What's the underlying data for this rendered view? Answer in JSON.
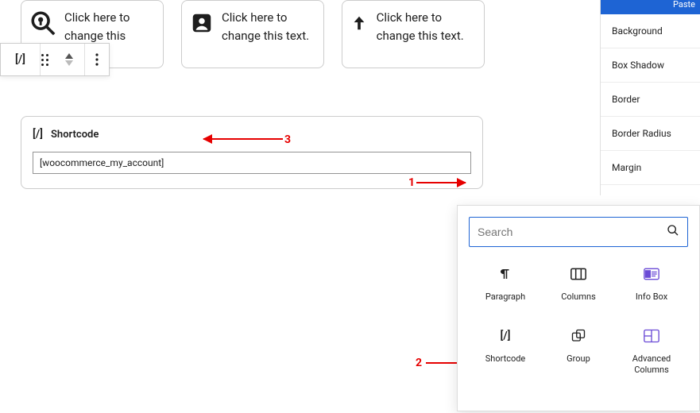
{
  "cards": [
    {
      "text": "Click here to change this"
    },
    {
      "text": "Click here to change this text."
    },
    {
      "text": "Click here to change this text."
    }
  ],
  "toolbar": {
    "shortcode_glyph": "[/]"
  },
  "shortcode_block": {
    "glyph": "[/]",
    "title": "Shortcode",
    "value": "[woocommerce_my_account]"
  },
  "appender": {
    "plus": "+"
  },
  "annotations": {
    "n1": "1",
    "n2": "2",
    "n3": "3"
  },
  "sidebar": {
    "paste": "Paste",
    "items": [
      "Background",
      "Box Shadow",
      "Border",
      "Border Radius",
      "Margin"
    ]
  },
  "inserter": {
    "search_placeholder": "Search",
    "blocks": [
      {
        "label": "Paragraph"
      },
      {
        "label": "Columns"
      },
      {
        "label": "Info Box"
      },
      {
        "label": "Shortcode"
      },
      {
        "label": "Group"
      },
      {
        "label": "Advanced\nColumns"
      }
    ]
  }
}
